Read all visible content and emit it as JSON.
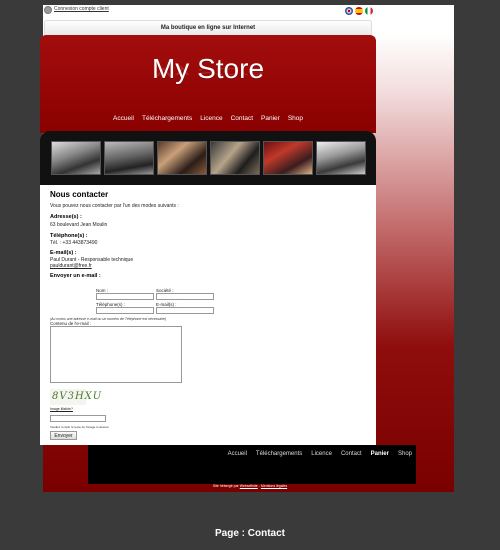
{
  "topbar": {
    "login_link": "Connexion compte client"
  },
  "tagline": "Ma boutique en ligne sur Internet",
  "header": {
    "title": "My Store"
  },
  "nav": [
    "Accueil",
    "Téléchargements",
    "Licence",
    "Contact",
    "Panier",
    "Shop"
  ],
  "content": {
    "heading": "Nous contacter",
    "intro": "Vous pouvez nous contacter par l'un des modes suivants :",
    "address_label": "Adresse(s) :",
    "address_value": "63 boulevard Jean Moulin",
    "phone_label": "Téléphone(s) :",
    "phone_value": "Tél. : +33 443873490",
    "email_label": "E-mail(s) :",
    "email_line1": "Paul Durant - Responsable technique",
    "email_line2": "pauldurant@free.fr",
    "send_label": "Envoyer un e-mail :"
  },
  "form": {
    "name_label": "Nom :",
    "company_label": "Société :",
    "phone_label": "Téléphone(s) :",
    "email_label": "E-mail(s) :",
    "note": "(Au moins une adresse e-mail ou un numéro de Téléphone est nécessaire)",
    "message_label": "Contenu de l'e-mail :",
    "captcha_text": "8V3HXU",
    "captcha_help": "Image illisible?",
    "captcha_note": "Veuillez remplir le texte de l'image ci-dessus",
    "send_button": "Envoyer"
  },
  "footer": {
    "active_item": "Panier",
    "credit_prefix": "Site hébergé par",
    "credit_host": "Webselfsite",
    "credit_sep": " - ",
    "credit_legal": "Mentions légales"
  },
  "caption": "Page : Contact"
}
